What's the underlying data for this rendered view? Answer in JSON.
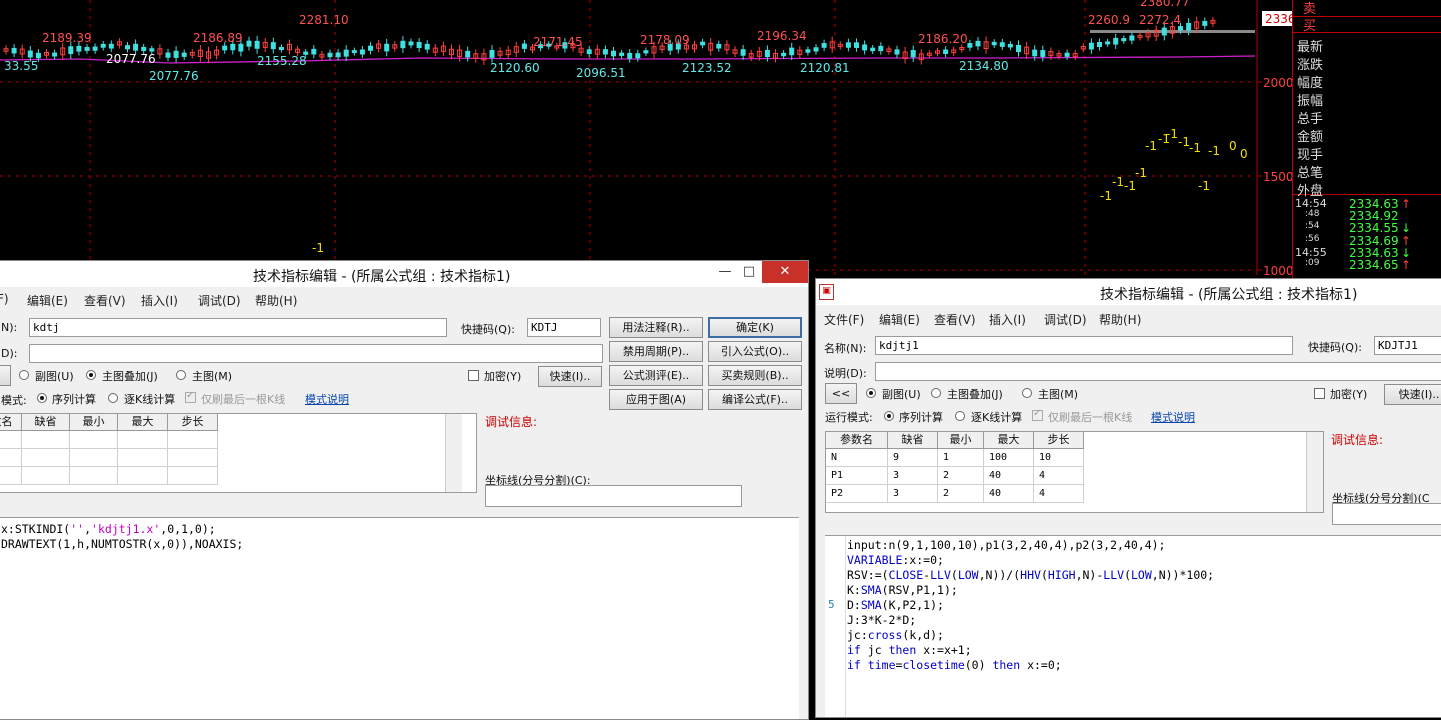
{
  "chart": {
    "price_labels_red": [
      "2189.39",
      "2186.89",
      "2281.10",
      "2171.45",
      "2178.09",
      "2196.34",
      "2186.20",
      "2260.9",
      "2272.4",
      "2380.77"
    ],
    "price_labels_cyan": [
      "33.55",
      "2077.76",
      "2155.28",
      "2120.60",
      "2096.51",
      "2123.52",
      "2120.81",
      "2134.80"
    ],
    "price_label_white": "2077.76",
    "axis_labels": [
      "2000",
      "1500",
      "1000"
    ],
    "current_price_tag": "2336",
    "kd_markers": [
      "-1",
      "-1",
      "-1",
      "-1",
      "-1",
      "-1",
      "-1",
      "-1",
      "-1",
      "-1",
      "0",
      "0",
      "-1",
      "-1",
      "-1"
    ]
  },
  "right_panel": {
    "sell_label": "卖",
    "buy_label": "买",
    "fields": [
      "最新",
      "涨跌",
      "幅度",
      "振幅",
      "总手",
      "金额",
      "现手",
      "总笔"
    ],
    "outer_label": "外盘",
    "tape": [
      {
        "time": "14:54",
        "price": "2334.63",
        "dir": "↑"
      },
      {
        "time": ":48",
        "price": "2334.92",
        "dir": ""
      },
      {
        "time": ":54",
        "price": "2334.55",
        "dir": "↓"
      },
      {
        "time": ":56",
        "price": "2334.69",
        "dir": "↑"
      },
      {
        "time": "14:55",
        "price": "2334.63",
        "dir": "↓"
      },
      {
        "time": ":09",
        "price": "2334.65",
        "dir": "↑"
      }
    ]
  },
  "left_editor": {
    "title": "技术指标编辑 - (所属公式组 : 技术指标1)",
    "menu": [
      "F)",
      "编辑(E)",
      "查看(V)",
      "插入(I)",
      "调试(D)",
      "帮助(H)"
    ],
    "name_label": "N):",
    "name_value": "kdtj",
    "desc_label": "D):",
    "shortcut_label": "快捷码(Q):",
    "shortcut_value": "KDTJ",
    "buttons": {
      "usage": "用法注释(R)..",
      "confirm": "确定(K)",
      "disable_period": "禁用周期(P)..",
      "import": "引入公式(O)..",
      "evaluate": "公式测评(E)..",
      "trade_rules": "买卖规则(B)..",
      "apply": "应用于图(A)",
      "compile": "编译公式(F)..",
      "fast": "快速(I).."
    },
    "radios": {
      "sub": "副图(U)",
      "main_overlay": "主图叠加(J)",
      "main": "主图(M)"
    },
    "encrypt_label": "加密(Y)",
    "mode_label": "模式:",
    "seq_calc": "序列计算",
    "tick_calc": "逐K线计算",
    "refresh_last": "仅刷最后一根K线",
    "mode_help": "模式说明",
    "debug_label": "调试信息:",
    "axis_label": "坐标线(分号分割)(C):",
    "columns": [
      "数名",
      "缺省",
      "最小",
      "最大",
      "步长"
    ],
    "code": [
      [
        {
          "t": "x:STKINDI(",
          "c": ""
        },
        {
          "t": "''",
          "c": "str"
        },
        {
          "t": ",",
          "c": ""
        },
        {
          "t": "'kdjtj1.x'",
          "c": "str"
        },
        {
          "t": ",0,1,0);",
          "c": ""
        }
      ],
      [
        {
          "t": "DRAWTEXT(1,h,NUMTOSTR(x,0)),NOAXIS;",
          "c": ""
        }
      ]
    ]
  },
  "right_editor": {
    "title": "技术指标编辑 - (所属公式组 : 技术指标1)",
    "menu": [
      "文件(F)",
      "编辑(E)",
      "查看(V)",
      "插入(I)",
      "调试(D)",
      "帮助(H)"
    ],
    "name_label": "名称(N):",
    "name_value": "kdjtj1",
    "desc_label": "说明(D):",
    "shortcut_label": "快捷码(Q):",
    "shortcut_value": "KDJTJ1",
    "collapse_btn": "<<",
    "radios": {
      "sub": "副图(U)",
      "main_overlay": "主图叠加(J)",
      "main": "主图(M)"
    },
    "encrypt_label": "加密(Y)",
    "fast_btn": "快速(I)..",
    "mode_label": "运行模式:",
    "seq_calc": "序列计算",
    "tick_calc": "逐K线计算",
    "refresh_last": "仅刷最后一根K线",
    "mode_help": "模式说明",
    "debug_label": "调试信息:",
    "axis_label": "坐标线(分号分割)(C",
    "columns": [
      "参数名",
      "缺省",
      "最小",
      "最大",
      "步长"
    ],
    "rows": [
      [
        "N",
        "9",
        "1",
        "100",
        "10"
      ],
      [
        "P1",
        "3",
        "2",
        "40",
        "4"
      ],
      [
        "P2",
        "3",
        "2",
        "40",
        "4"
      ]
    ],
    "gutter_line": "5",
    "code": [
      [
        {
          "t": "input:n(9,1,100,10),p1(3,2,40,4),p2(3,2,40,4);",
          "c": ""
        }
      ],
      [
        {
          "t": "VARIABLE",
          "c": "kw"
        },
        {
          "t": ":x:=0;",
          "c": ""
        }
      ],
      [
        {
          "t": "RSV:=(",
          "c": ""
        },
        {
          "t": "CLOSE",
          "c": "kw"
        },
        {
          "t": "-",
          "c": ""
        },
        {
          "t": "LLV",
          "c": "kw"
        },
        {
          "t": "(",
          "c": ""
        },
        {
          "t": "LOW",
          "c": "kw"
        },
        {
          "t": ",N))/(",
          "c": ""
        },
        {
          "t": "HHV",
          "c": "kw"
        },
        {
          "t": "(",
          "c": ""
        },
        {
          "t": "HIGH",
          "c": "kw"
        },
        {
          "t": ",N)-",
          "c": ""
        },
        {
          "t": "LLV",
          "c": "kw"
        },
        {
          "t": "(",
          "c": ""
        },
        {
          "t": "LOW",
          "c": "kw"
        },
        {
          "t": ",N))*100;",
          "c": ""
        }
      ],
      [
        {
          "t": "K:",
          "c": ""
        },
        {
          "t": "SMA",
          "c": "kw"
        },
        {
          "t": "(RSV,P1,1);",
          "c": ""
        }
      ],
      [
        {
          "t": "D:",
          "c": ""
        },
        {
          "t": "SMA",
          "c": "kw"
        },
        {
          "t": "(K,P2,1);",
          "c": ""
        }
      ],
      [
        {
          "t": "J:3*K-2*D;",
          "c": ""
        }
      ],
      [
        {
          "t": "jc:",
          "c": ""
        },
        {
          "t": "cross",
          "c": "kw"
        },
        {
          "t": "(k,d);",
          "c": ""
        }
      ],
      [
        {
          "t": "if",
          "c": "kw"
        },
        {
          "t": " jc ",
          "c": ""
        },
        {
          "t": "then",
          "c": "kw"
        },
        {
          "t": " x:=x+1;",
          "c": ""
        }
      ],
      [
        {
          "t": "if",
          "c": "kw"
        },
        {
          "t": " ",
          "c": ""
        },
        {
          "t": "time",
          "c": "kw"
        },
        {
          "t": "=",
          "c": ""
        },
        {
          "t": "closetime",
          "c": "kw"
        },
        {
          "t": "(0) ",
          "c": ""
        },
        {
          "t": "then",
          "c": "kw"
        },
        {
          "t": " x:=0;",
          "c": ""
        }
      ]
    ]
  },
  "colors": {
    "up": "#ff4040",
    "down": "#40e0e0",
    "ma": "#d020d0",
    "marker": "#f0e000"
  }
}
